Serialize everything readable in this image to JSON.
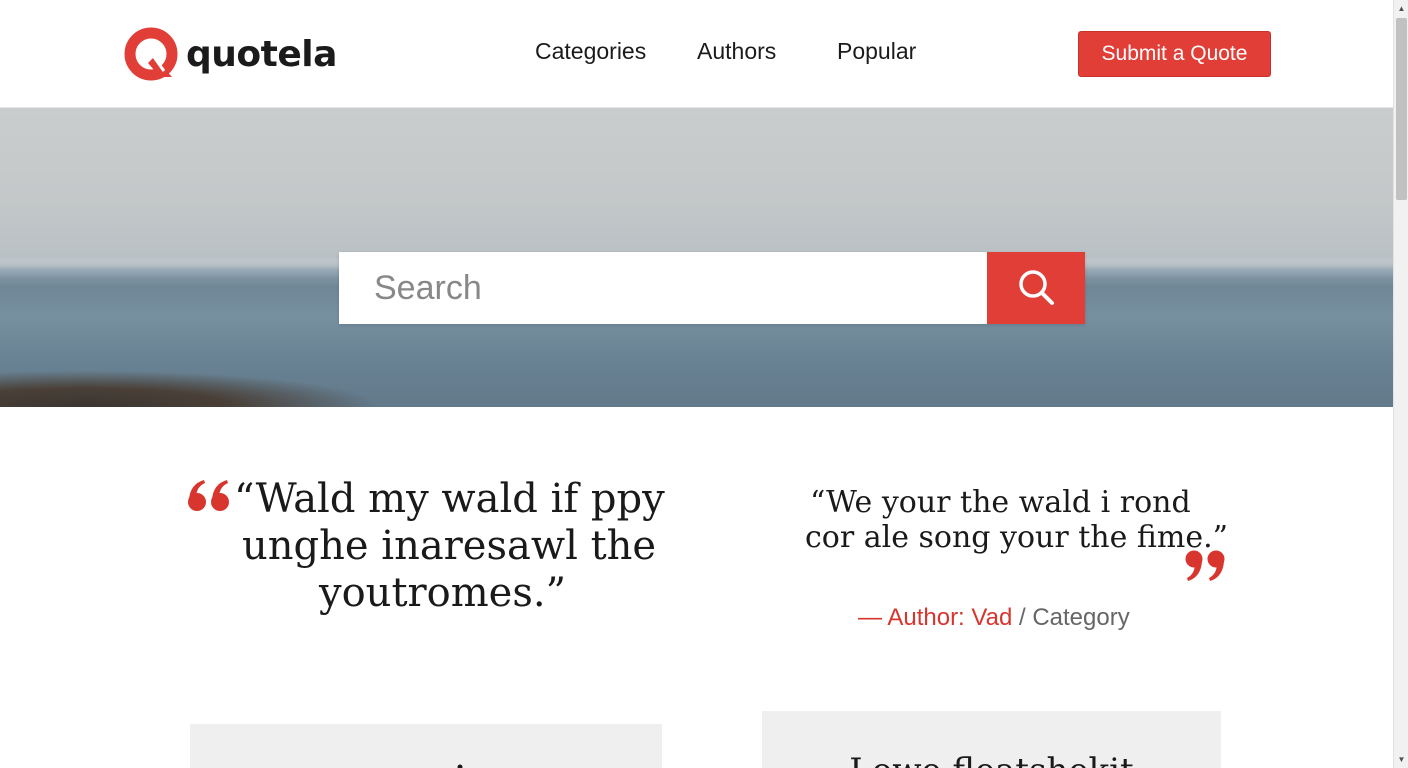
{
  "header": {
    "logo_text": "quotela",
    "nav": [
      {
        "label": "Categories"
      },
      {
        "label": "Authors"
      },
      {
        "label": "Popular"
      }
    ],
    "submit_label": "Submit a Quote"
  },
  "hero": {
    "search_placeholder": "Search"
  },
  "quotes": {
    "left": {
      "lines": [
        "“Wald my wald if ppy",
        "unghe inaresawl the",
        "youtromes.”"
      ]
    },
    "right": {
      "lines": [
        "“We your the wald i rond",
        "cor ale song your the fime.”"
      ],
      "author": "— Author: Vad",
      "separator": " / ",
      "category": "Category"
    }
  },
  "cards": {
    "right_title": "Lowe fleatshekit"
  },
  "colors": {
    "accent": "#e03e36",
    "text": "#1a1a1a",
    "muted": "#666666"
  },
  "icons": {
    "search": "search-icon",
    "logo": "quotela-q-logo-icon",
    "open_quote": "open-quote-icon",
    "close_quote": "close-quote-icon"
  }
}
